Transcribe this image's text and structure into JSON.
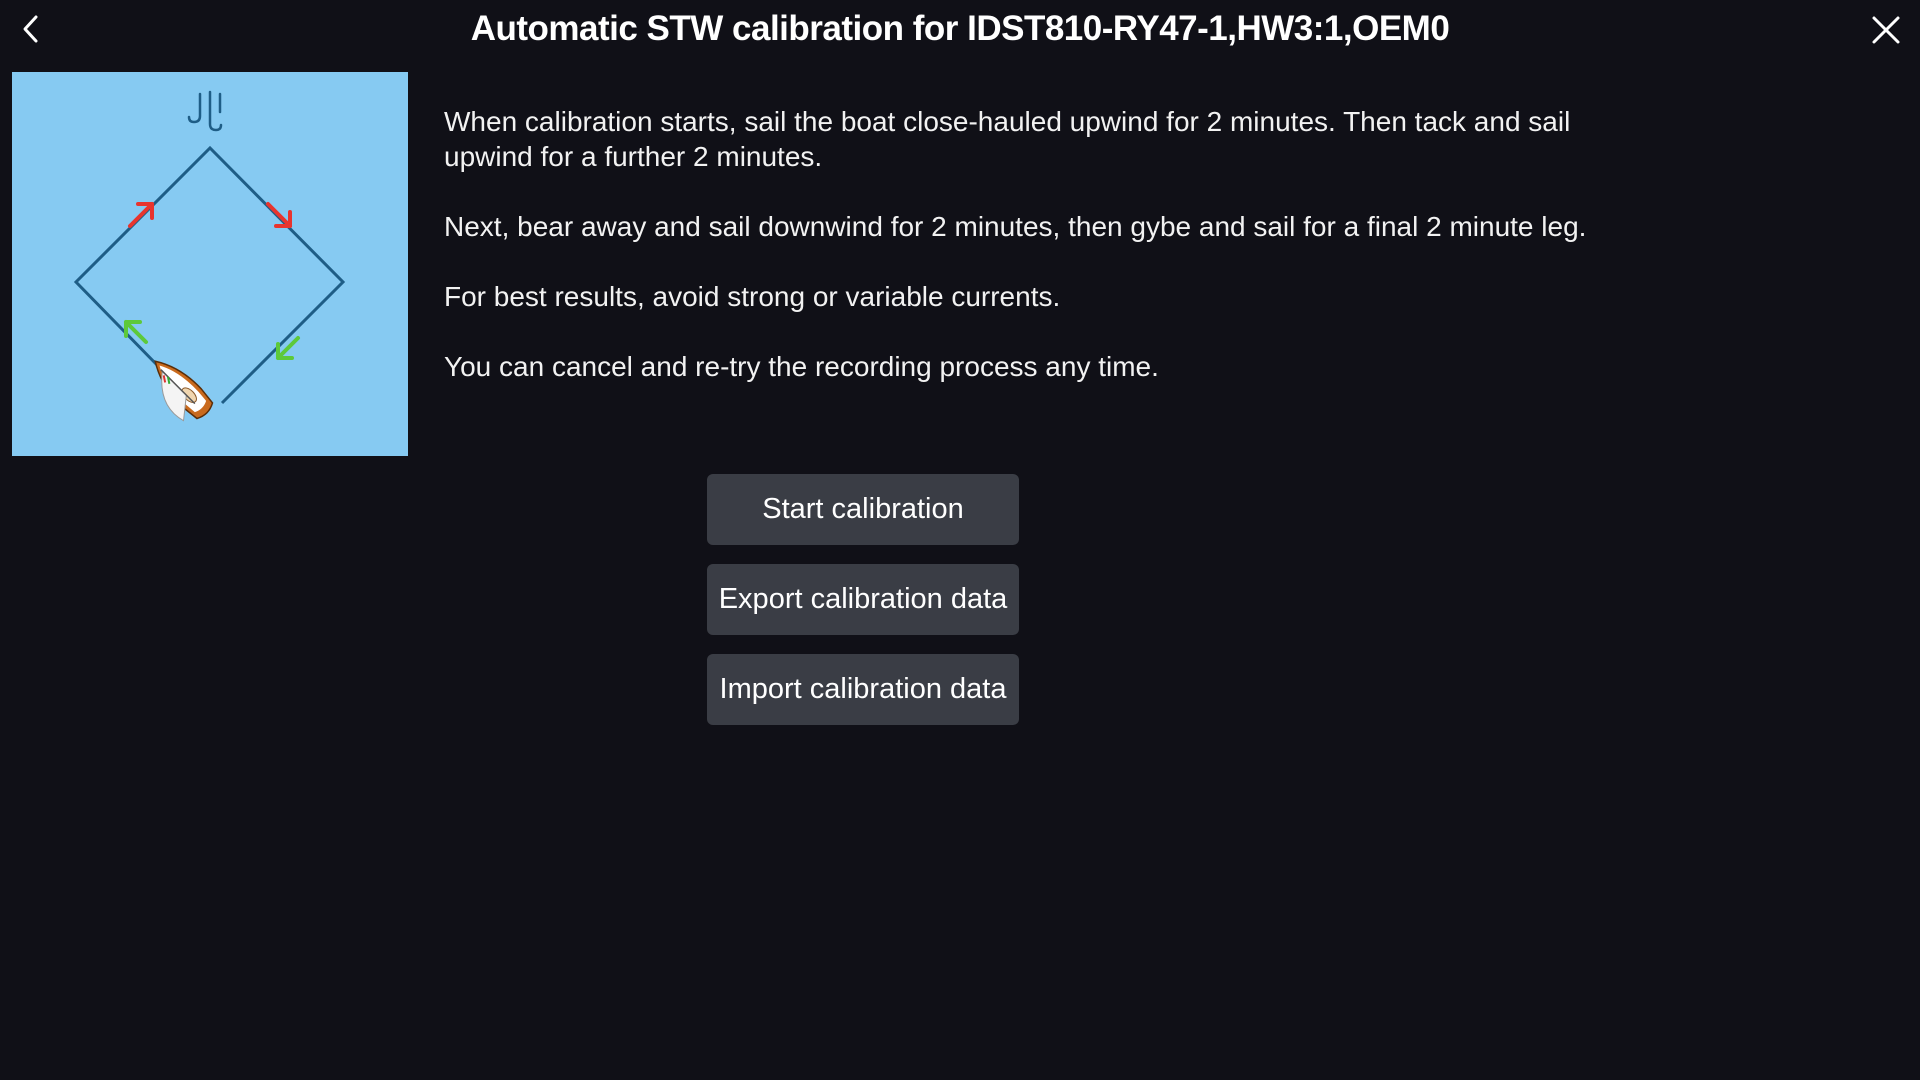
{
  "header": {
    "title": "Automatic STW calibration for IDST810-RY47-1,HW3:1,OEM0",
    "back_icon": "chevron-left-icon",
    "close_icon": "close-icon"
  },
  "illustration": {
    "background_color": "#86caf2",
    "course_color": "#1e5d86",
    "upwind_arrow_color": "#e8342e",
    "downwind_arrow_color": "#5dc93a",
    "wind_icon": "wind-icon",
    "boat_icon": "boat-icon"
  },
  "instructions": [
    "When calibration starts, sail the boat close-hauled upwind for 2 minutes. Then tack and sail upwind for a further 2 minutes.",
    "Next, bear away and sail downwind for 2 minutes, then gybe and sail for a final 2 minute leg.",
    "For best results, avoid strong or variable currents.",
    "You can cancel and re-try the recording process any time."
  ],
  "actions": {
    "start_label": "Start calibration",
    "export_label": "Export calibration data",
    "import_label": "Import calibration data"
  }
}
